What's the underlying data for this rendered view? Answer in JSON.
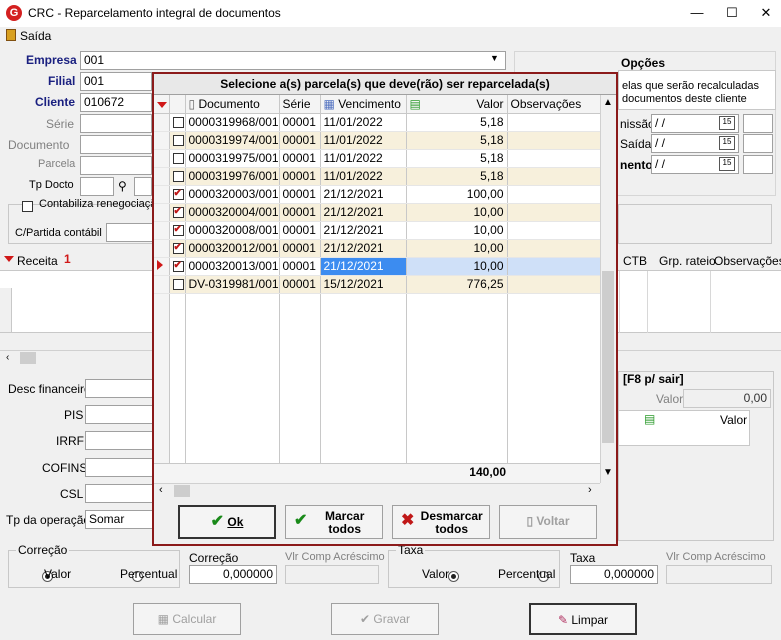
{
  "window": {
    "title": "CRC - Reparcelamento integral de documentos",
    "minimize": "—",
    "maximize": "☐",
    "close": "✕"
  },
  "menu": {
    "exit": "Saída"
  },
  "form": {
    "empresa_label": "Empresa",
    "empresa_value": "001",
    "filial_label": "Filial",
    "filial_value": "001",
    "cliente_label": "Cliente",
    "cliente_value": "010672",
    "serie_label": "Série",
    "documento_label": "Documento",
    "parcela_label": "Parcela",
    "tpdocto_label": "Tp Docto",
    "contabiliza_label": "Contabiliza renegociaçã",
    "cpartida_label": "C/Partida contábil"
  },
  "options_panel": {
    "title": "Opções",
    "line1": "elas que serão recalculadas",
    "line2": "documentos deste cliente",
    "emissao_label": "nissão",
    "emissao_value": "/ /",
    "saida_label": "Saída",
    "saida_value": "/ /",
    "vencimento_label": "nento",
    "vencimento_value": "/ /",
    "cal_icon_text": "15"
  },
  "receita_grid": {
    "title": "Receita",
    "counter": "1",
    "cols": [
      "CTB",
      "Grp. rateio",
      "Observações"
    ]
  },
  "f8_panel": {
    "title": "[F8 p/ sair]",
    "valor_label": "Valor",
    "valor_value": "0,00",
    "col_valor": "Valor"
  },
  "taxes": {
    "desc_financeiro": "Desc financeiro",
    "pis": "PIS",
    "irrf": "IRRF",
    "cofins": "COFINS",
    "csl": "CSL",
    "tp_operacao_label": "Tp da operação",
    "tp_operacao_value": "Somar"
  },
  "correcao": {
    "group": "Correção",
    "valor": "Valor",
    "percentual": "Percentual",
    "correcao_label": "Correção",
    "correcao_value": "0,000000",
    "vlr_comp": "Vlr Comp Acréscimo"
  },
  "taxa": {
    "group": "Taxa",
    "valor": "Valor",
    "percentual": "Percentual",
    "taxa_label": "Taxa",
    "taxa_value": "0,000000",
    "vlr_comp": "Vlr Comp Acréscimo"
  },
  "bottom_buttons": {
    "calcular": "Calcular",
    "gravar": "Gravar",
    "limpar": "Limpar"
  },
  "modal": {
    "title": "Selecione a(s) parcela(s) que deve(rão) ser reparcelada(s)",
    "columns": {
      "documento": "Documento",
      "serie": "Série",
      "vencimento": "Vencimento",
      "valor": "Valor",
      "observacoes": "Observações"
    },
    "rows": [
      {
        "checked": false,
        "documento": "0000319968/001",
        "serie": "00001",
        "vencimento": "11/01/2022",
        "valor": "5,18",
        "observacoes": ""
      },
      {
        "checked": false,
        "documento": "0000319974/001",
        "serie": "00001",
        "vencimento": "11/01/2022",
        "valor": "5,18",
        "observacoes": ""
      },
      {
        "checked": false,
        "documento": "0000319975/001",
        "serie": "00001",
        "vencimento": "11/01/2022",
        "valor": "5,18",
        "observacoes": ""
      },
      {
        "checked": false,
        "documento": "0000319976/001",
        "serie": "00001",
        "vencimento": "11/01/2022",
        "valor": "5,18",
        "observacoes": ""
      },
      {
        "checked": true,
        "documento": "0000320003/001",
        "serie": "00001",
        "vencimento": "21/12/2021",
        "valor": "100,00",
        "observacoes": ""
      },
      {
        "checked": true,
        "documento": "0000320004/001",
        "serie": "00001",
        "vencimento": "21/12/2021",
        "valor": "10,00",
        "observacoes": ""
      },
      {
        "checked": true,
        "documento": "0000320008/001",
        "serie": "00001",
        "vencimento": "21/12/2021",
        "valor": "10,00",
        "observacoes": ""
      },
      {
        "checked": true,
        "documento": "0000320012/001",
        "serie": "00001",
        "vencimento": "21/12/2021",
        "valor": "10,00",
        "observacoes": ""
      },
      {
        "checked": true,
        "documento": "0000320013/001",
        "serie": "00001",
        "vencimento": "21/12/2021",
        "valor": "10,00",
        "observacoes": "",
        "current": true
      },
      {
        "checked": false,
        "documento": "DV-0319981/001",
        "serie": "00001",
        "vencimento": "15/12/2021",
        "valor": "776,25",
        "observacoes": ""
      }
    ],
    "total": "140,00",
    "buttons": {
      "ok": "Ok",
      "marcar": "Marcar todos",
      "desmarcar": "Desmarcar todos",
      "voltar": "Voltar"
    }
  }
}
